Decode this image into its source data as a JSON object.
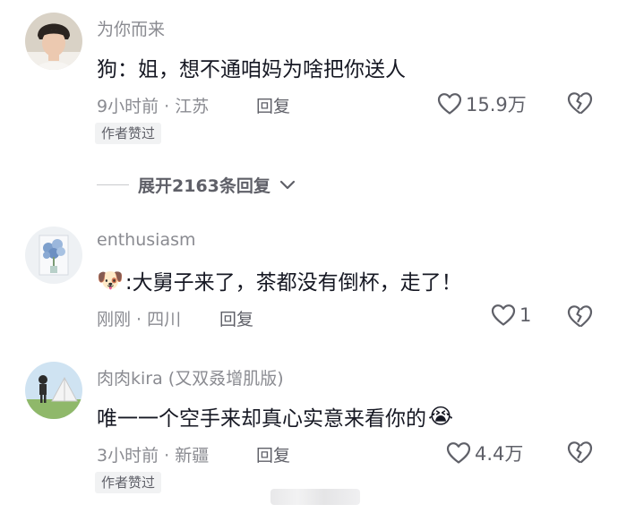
{
  "comments": [
    {
      "username": "为你而来",
      "text": "狗：姐，想不通咱妈为啥把你送人",
      "emoji_prefix": "",
      "emoji_suffix": "",
      "time_location": "9小时前 · 江苏",
      "reply_label": "回复",
      "likes": "15.9万",
      "badge": "作者赞过"
    },
    {
      "username": "enthusiasm",
      "text": ":大舅子来了，茶都没有倒杯，走了！",
      "emoji_prefix": "🐶",
      "emoji_suffix": "",
      "time_location": "刚刚 · 四川",
      "reply_label": "回复",
      "likes": "1",
      "badge": ""
    },
    {
      "username": "肉肉kira (又双叒增肌版)",
      "text": "唯一一个空手来却真心实意来看你的",
      "emoji_prefix": "",
      "emoji_suffix": "😭",
      "time_location": "3小时前 · 新疆",
      "reply_label": "回复",
      "likes": "4.4万",
      "badge": "作者赞过"
    }
  ],
  "expand_replies": "展开2163条回复",
  "icons": {
    "like": "heart-outline-icon",
    "dislike": "broken-heart-icon",
    "expand": "chevron-down-icon"
  },
  "colors": {
    "text_primary": "#161823",
    "text_secondary": "#8a8b91",
    "badge_bg": "#f1f2f3"
  }
}
